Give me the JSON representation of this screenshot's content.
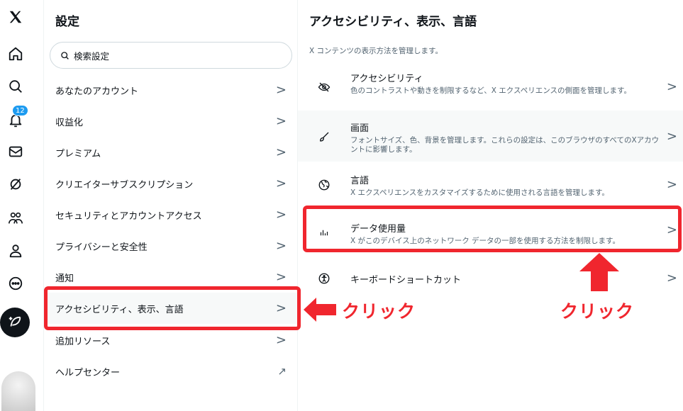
{
  "nav": {
    "notification_count": "12",
    "icons": [
      "x-logo-icon",
      "home-icon",
      "search-icon",
      "bell-icon",
      "mail-icon",
      "grok-icon",
      "communities-icon",
      "profile-icon",
      "more-icon",
      "post-icon"
    ]
  },
  "settings": {
    "title": "設定",
    "search_placeholder": "検索設定",
    "items": [
      {
        "label": "あなたのアカウント",
        "chevron": ">"
      },
      {
        "label": "収益化",
        "chevron": ">"
      },
      {
        "label": "プレミアム",
        "chevron": ">"
      },
      {
        "label": "クリエイターサブスクリプション",
        "chevron": ">"
      },
      {
        "label": "セキュリティとアカウントアクセス",
        "chevron": ">"
      },
      {
        "label": "プライバシーと安全性",
        "chevron": ">"
      },
      {
        "label": "通知",
        "chevron": ">"
      },
      {
        "label": "アクセシビリティ、表示、言語",
        "chevron": ">"
      },
      {
        "label": "追加リソース",
        "chevron": ">"
      },
      {
        "label": "ヘルプセンター",
        "chevron": "↗"
      }
    ]
  },
  "detail": {
    "title": "アクセシビリティ、表示、言語",
    "description": "X コンテンツの表示方法を管理します。",
    "items": [
      {
        "label": "アクセシビリティ",
        "sub": "色のコントラストや動きを制限するなど、X エクスペリエンスの側面を管理します。",
        "chevron": ">"
      },
      {
        "label": "画面",
        "sub": "フォントサイズ、色、背景を管理します。これらの設定は、このブラウザのすべてのXアカウントに影響します。",
        "chevron": ">"
      },
      {
        "label": "言語",
        "sub": "X エクスペリエンスをカスタマイズするために使用される言語を管理します。",
        "chevron": ">"
      },
      {
        "label": "データ使用量",
        "sub": "X がこのデバイス上のネットワーク データの一部を使用する方法を制限します。",
        "chevron": ">"
      },
      {
        "label": "キーボードショートカット",
        "sub": "",
        "chevron": ">"
      }
    ]
  },
  "annotations": {
    "click_left": "クリック",
    "click_right": "クリック",
    "highlight_color": "#f0262e"
  }
}
